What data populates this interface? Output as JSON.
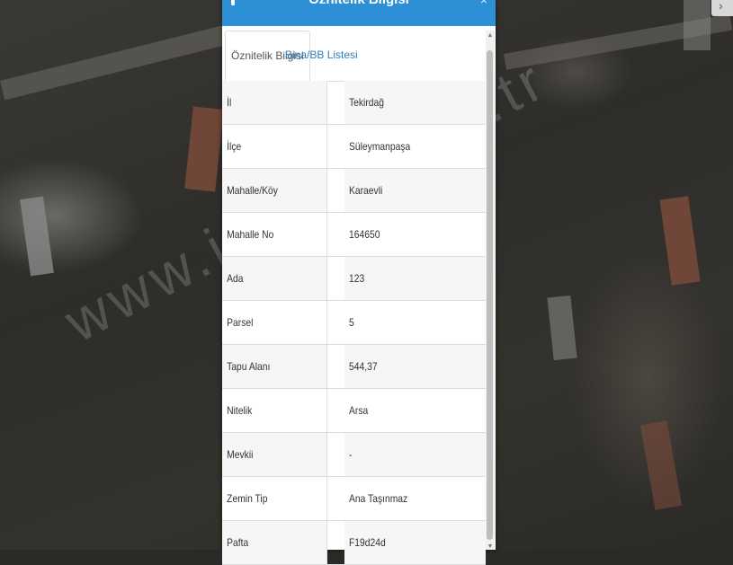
{
  "panel": {
    "title": "Öznitelik Bilgisi",
    "close": "×"
  },
  "tabs": [
    {
      "label": "Öznitelik Bilgisi",
      "active": true
    },
    {
      "label": "Bina/BB Listesi",
      "active": false
    }
  ],
  "rows": [
    {
      "key": "İl",
      "value": "Tekirdağ"
    },
    {
      "key": "İlçe",
      "value": "Süleymanpaşa"
    },
    {
      "key": "Mahalle/Köy",
      "value": "Karaevli"
    },
    {
      "key": "Mahalle No",
      "value": "164650"
    },
    {
      "key": "Ada",
      "value": "123"
    },
    {
      "key": "Parsel",
      "value": "5"
    },
    {
      "key": "Tapu Alanı",
      "value": "544,37"
    },
    {
      "key": "Nitelik",
      "value": "Arsa"
    },
    {
      "key": "Mevkii",
      "value": "-"
    },
    {
      "key": "Zemin Tip",
      "value": "Ana Taşınmaz"
    },
    {
      "key": "Pafta",
      "value": "F19d24d"
    }
  ],
  "watermark": "www.i...e...com.tr",
  "colors": {
    "header": "#2d8fd5",
    "link": "#2d7fc0"
  }
}
